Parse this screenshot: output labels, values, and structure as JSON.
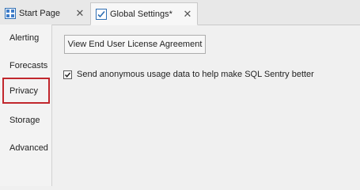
{
  "tabs": [
    {
      "label": "Start Page",
      "icon": "start-page-grid-icon",
      "active": false
    },
    {
      "label": "Global Settings*",
      "icon": "settings-checklist-icon",
      "active": true
    }
  ],
  "sidebar": {
    "items": [
      {
        "label": "Alerting",
        "selected": false
      },
      {
        "label": "Forecasts",
        "selected": false
      },
      {
        "label": "Privacy",
        "selected": true
      },
      {
        "label": "Storage",
        "selected": false
      },
      {
        "label": "Advanced",
        "selected": false
      }
    ],
    "selected_border_color": "#c1272d"
  },
  "privacy": {
    "eula_button_label": "View End User License Agreement",
    "usage_data_label": "Send anonymous usage data to help make SQL Sentry better",
    "usage_data_checked": true
  }
}
